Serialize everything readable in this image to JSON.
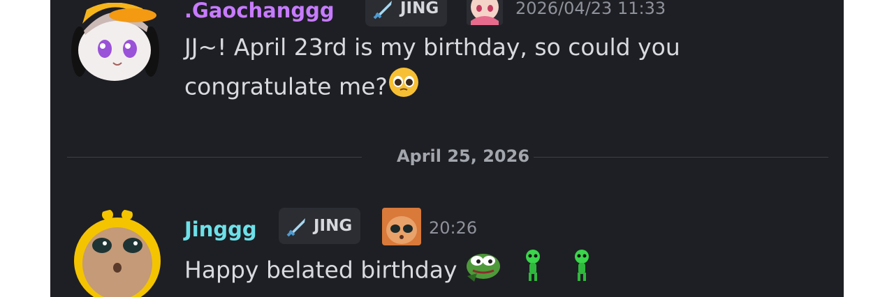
{
  "messages": [
    {
      "author": ".Gaochanggg",
      "author_color": "#c77bff",
      "role_badge": "JING",
      "timestamp": "2026/04/23 11:33",
      "text_line1": "JJ~! April 23rd is my birthday, so could you",
      "text_line2": "congratulate me?",
      "avatar_icon": "anime-girl-duck-hat-avatar",
      "trailing_emoji": "pleading-face-emoji"
    },
    {
      "author": "Jinggg",
      "author_color": "#6ee0e8",
      "role_badge": "JING",
      "timestamp": "20:26",
      "text": "Happy belated birthday",
      "avatar_icon": "cat-avatar",
      "trailing_emojis": [
        "pepe-frog-emoji",
        "green-alien-emoji",
        "green-alien-emoji"
      ]
    }
  ],
  "date_divider": "April 25, 2026",
  "colors": {
    "background": "#1e1f24",
    "badge": "#2b2d33",
    "text": "#d8dadf",
    "timestamp": "#8f929a"
  }
}
